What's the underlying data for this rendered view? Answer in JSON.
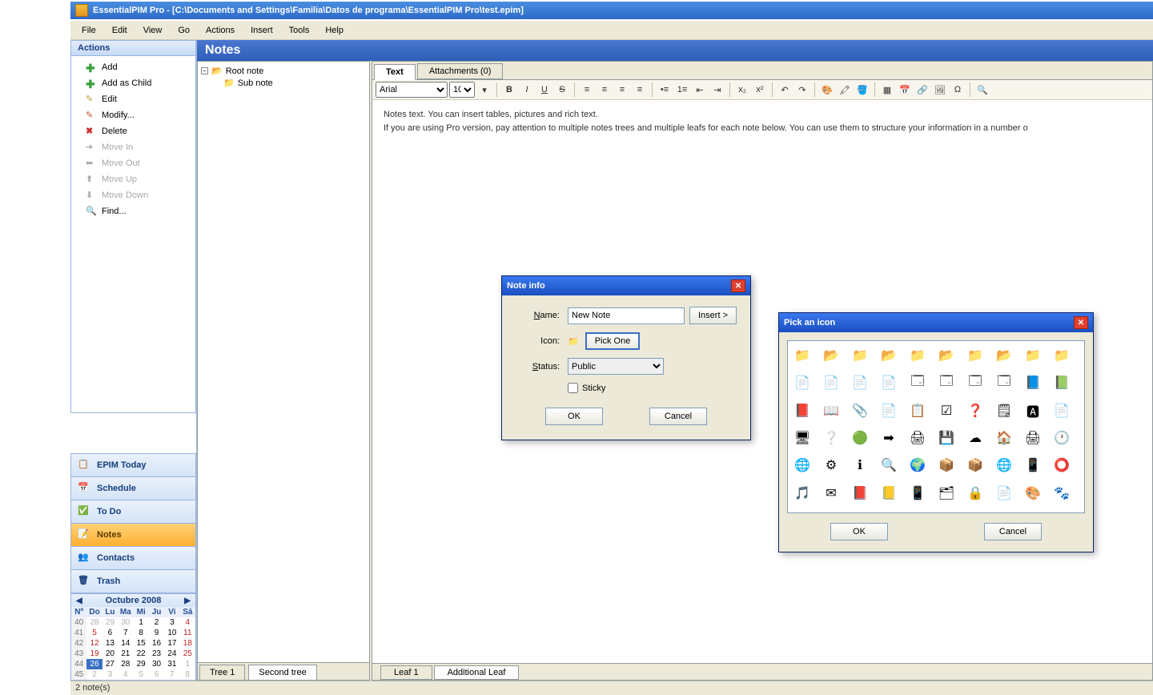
{
  "window": {
    "title": "EssentialPIM Pro - [C:\\Documents and Settings\\Familia\\Datos de programa\\EssentialPIM Pro\\test.epim]"
  },
  "menu": [
    "File",
    "Edit",
    "View",
    "Go",
    "Actions",
    "Insert",
    "Tools",
    "Help"
  ],
  "actions": {
    "header": "Actions",
    "items": [
      {
        "label": "Add",
        "icon": "plus",
        "enabled": true
      },
      {
        "label": "Add as Child",
        "icon": "plus",
        "enabled": true
      },
      {
        "label": "Edit",
        "icon": "edit",
        "enabled": true
      },
      {
        "label": "Modify...",
        "icon": "modify",
        "enabled": true
      },
      {
        "label": "Delete",
        "icon": "delete",
        "enabled": true
      },
      {
        "label": "Move In",
        "icon": "arrow-right",
        "enabled": false
      },
      {
        "label": "Move Out",
        "icon": "arrow-left",
        "enabled": false
      },
      {
        "label": "Move Up",
        "icon": "arrow-up",
        "enabled": false
      },
      {
        "label": "Move Down",
        "icon": "arrow-down",
        "enabled": false
      },
      {
        "label": "Find...",
        "icon": "find",
        "enabled": true
      }
    ]
  },
  "nav": [
    {
      "label": "EPIM Today",
      "icon": "📋",
      "active": false
    },
    {
      "label": "Schedule",
      "icon": "📅",
      "active": false
    },
    {
      "label": "To Do",
      "icon": "✅",
      "active": false
    },
    {
      "label": "Notes",
      "icon": "📝",
      "active": true
    },
    {
      "label": "Contacts",
      "icon": "👥",
      "active": false
    },
    {
      "label": "Trash",
      "icon": "🗑",
      "active": false
    }
  ],
  "calendar": {
    "title": "Octubre  2008",
    "dow": [
      "Nº",
      "Do",
      "Lu",
      "Ma",
      "Mi",
      "Ju",
      "Vi",
      "Sá"
    ],
    "rows": [
      {
        "wk": "40",
        "d": [
          "28",
          "29",
          "30",
          "1",
          "2",
          "3",
          "4"
        ],
        "dim": [
          0,
          1,
          2
        ],
        "red": [
          6
        ]
      },
      {
        "wk": "41",
        "d": [
          "5",
          "6",
          "7",
          "8",
          "9",
          "10",
          "11"
        ],
        "dim": [],
        "red": [
          0,
          6
        ]
      },
      {
        "wk": "42",
        "d": [
          "12",
          "13",
          "14",
          "15",
          "16",
          "17",
          "18"
        ],
        "dim": [],
        "red": [
          0,
          6
        ]
      },
      {
        "wk": "43",
        "d": [
          "19",
          "20",
          "21",
          "22",
          "23",
          "24",
          "25"
        ],
        "dim": [],
        "red": [
          0,
          6
        ]
      },
      {
        "wk": "44",
        "d": [
          "26",
          "27",
          "28",
          "29",
          "30",
          "31",
          "1"
        ],
        "dim": [
          6
        ],
        "red": [
          0
        ],
        "today": 0
      },
      {
        "wk": "45",
        "d": [
          "2",
          "3",
          "4",
          "5",
          "6",
          "7",
          "8"
        ],
        "dim": [
          0,
          1,
          2,
          3,
          4,
          5,
          6
        ],
        "red": []
      }
    ]
  },
  "notes": {
    "header": "Notes",
    "tree": {
      "root": "Root note",
      "sub": "Sub note"
    },
    "tree_tabs": [
      "Tree 1",
      "Second tree"
    ],
    "editor_tabs": [
      "Text",
      "Attachments (0)"
    ],
    "leaf_tabs": [
      "Leaf 1",
      "Additional Leaf"
    ],
    "font": "Arial",
    "size": "10",
    "body_line1": "Notes text. You can insert tables, pictures and rich text.",
    "body_line2": "If you are using Pro version, pay attention to multiple notes trees and multiple leafs for each note below. You can use them to structure your information in a number o"
  },
  "status": "2 note(s)",
  "note_info": {
    "title": "Note info",
    "name_label": "Name:",
    "name_value": "New Note",
    "insert": "Insert >",
    "icon_label": "Icon:",
    "pickone": "Pick One",
    "status_label": "Status:",
    "status_value": "Public",
    "sticky": "Sticky",
    "ok": "OK",
    "cancel": "Cancel"
  },
  "icon_picker": {
    "title": "Pick an icon",
    "ok": "OK",
    "cancel": "Cancel",
    "icons": [
      "📁",
      "📂",
      "📁",
      "📂",
      "📁",
      "📂",
      "📁",
      "📂",
      "📁",
      "📁",
      "📄",
      "📄",
      "📄",
      "📄",
      "🗔",
      "🗔",
      "🗔",
      "🗔",
      "📘",
      "📗",
      "📕",
      "📖",
      "📎",
      "📄",
      "📋",
      "☑",
      "❓",
      "🗒",
      "🅰",
      "📄",
      "🖥",
      "❔",
      "🟢",
      "➡",
      "🖨",
      "💾",
      "☁",
      "🏠",
      "🖨",
      "🕐",
      "🌐",
      "⚙",
      "ℹ",
      "🔍",
      "🌍",
      "📦",
      "📦",
      "🌐",
      "📱",
      "⭕",
      "🎵",
      "✉",
      "📕",
      "📒",
      "📱",
      "🗂",
      "🔒",
      "📄",
      "🎨",
      "🐾"
    ]
  }
}
